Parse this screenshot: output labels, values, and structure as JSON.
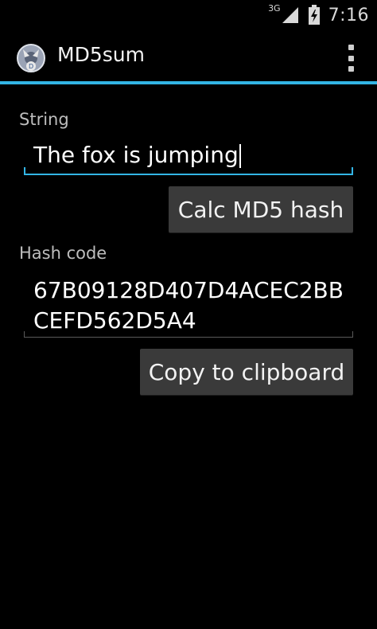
{
  "status_bar": {
    "network": "3G",
    "time": "7:16"
  },
  "action_bar": {
    "title": "MD5sum",
    "accent_color": "#33b5e5"
  },
  "form": {
    "string_label": "String",
    "string_value": "The fox is jumping",
    "calc_button": "Calc MD5 hash",
    "hash_label": "Hash code",
    "hash_line1": "67B09128D407D4ACEC2BB",
    "hash_line2": "CEFD562D5A4",
    "copy_button": "Copy to clipboard"
  },
  "icons": [
    "signal-icon",
    "battery-icon",
    "app-icon",
    "overflow-menu-icon"
  ]
}
